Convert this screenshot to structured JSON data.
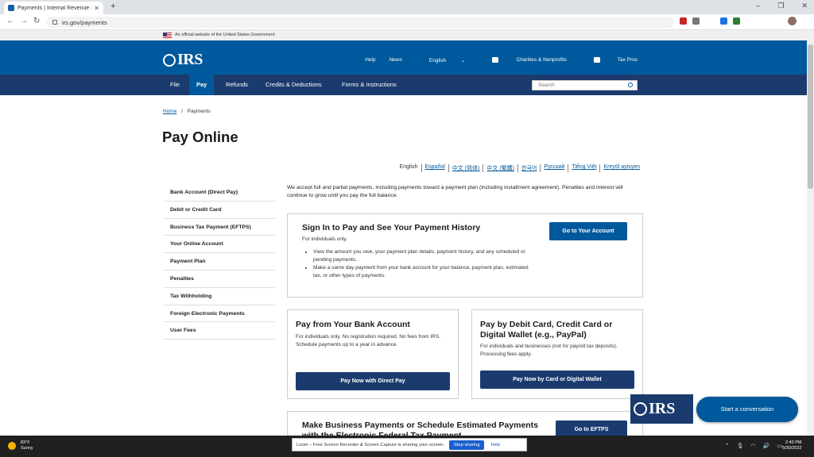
{
  "browser": {
    "tab_title": "Payments | Internal Revenue Serv",
    "new_tab": "+",
    "url": "irs.gov/payments"
  },
  "gov_banner": "An official website of the United States Government",
  "header": {
    "logo": "IRS",
    "links": [
      "Help",
      "News",
      "English",
      "Charities & Nonprofits",
      "Tax Pros"
    ]
  },
  "nav": {
    "items": [
      "File",
      "Pay",
      "Refunds",
      "Credits & Deductions",
      "Forms & Instructions"
    ],
    "search_placeholder": "Search"
  },
  "breadcrumb": {
    "home": "Home",
    "sep": "/",
    "current": "Payments"
  },
  "page_title": "Pay Online",
  "languages": [
    "English",
    "Español",
    "中文 (简体)",
    "中文 (繁體)",
    "한국어",
    "Русский",
    "Tiếng Việt",
    "Kreyòl ayisyen"
  ],
  "sidebar": [
    "Bank Account (Direct Pay)",
    "Debit or Credit Card",
    "Business Tax Payment (EFTPS)",
    "Your Online Account",
    "Payment Plan",
    "Penalties",
    "Tax Withholding",
    "Foreign Electronic Payments",
    "User Fees"
  ],
  "intro": "We accept full and partial payments, including payments toward a payment plan (including installment agreement). Penalties and interest will continue to grow until you pay the full balance.",
  "card_account": {
    "title": "Sign In to Pay and See Your Payment History",
    "subtitle": "For individuals only.",
    "bullets": [
      "View the amount you owe, your payment plan details, payment history, and any scheduled or pending payments.",
      "Make a same day payment from your bank account for your balance, payment plan, estimated tax, or other types of payments."
    ],
    "button": "Go to Your Account"
  },
  "card_bank": {
    "title": "Pay from Your Bank Account",
    "text": "For individuals only. No registration required. No fees from IRS. Schedule payments up to a year in advance.",
    "button": "Pay Now with Direct Pay"
  },
  "card_card": {
    "title": "Pay by Debit Card, Credit Card or Digital Wallet (e.g., PayPal)",
    "text": "For individuals and businesses (not for payroll tax deposits). Processing fees apply.",
    "button": "Pay Now by Card or Digital Wallet"
  },
  "card_business": {
    "title": "Make Business Payments or Schedule Estimated Payments with the Electronic Federal Tax Payment",
    "button": "Go to EFTPS"
  },
  "chat": {
    "logo": "IRS",
    "button": "Start a conversation"
  },
  "taskbar": {
    "temp": "83°F",
    "condition": "Sunny",
    "loom_text": "Loom – Free Screen Recorder & Screen Capture is sharing your screen.",
    "stop": "Stop sharing",
    "hide": "Hide",
    "time": "2:40 PM",
    "date": "5/30/2022"
  }
}
